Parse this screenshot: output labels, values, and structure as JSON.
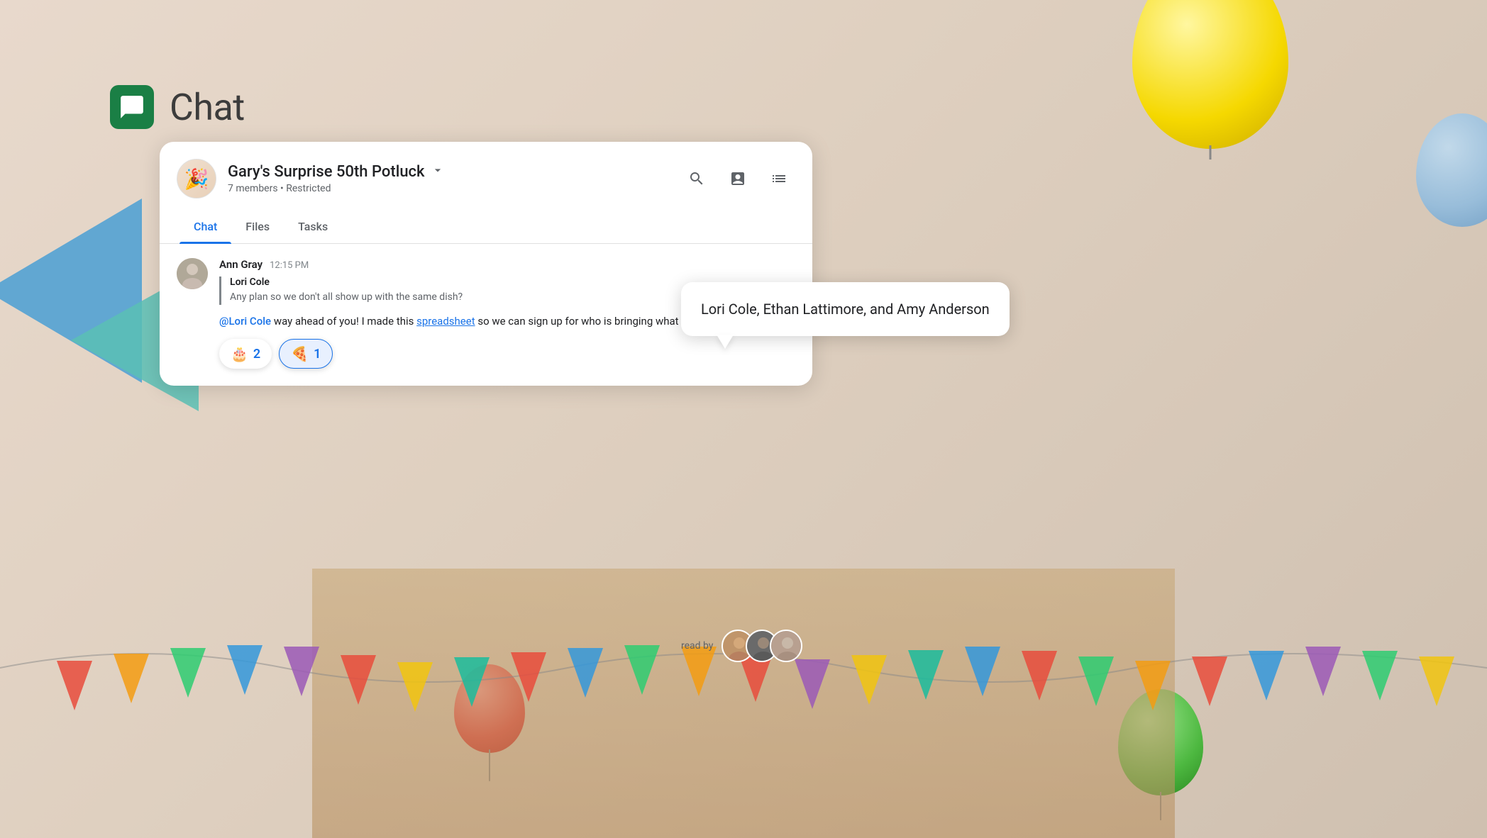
{
  "app": {
    "title": "Chat",
    "icon_emoji": "💬"
  },
  "group": {
    "name": "Gary's Surprise 50th Potluck",
    "members_count": "7 members",
    "restriction": "Restricted",
    "avatar_emoji": "🎉",
    "meta": "7 members • Restricted"
  },
  "tabs": [
    {
      "id": "chat",
      "label": "Chat",
      "active": true
    },
    {
      "id": "files",
      "label": "Files",
      "active": false
    },
    {
      "id": "tasks",
      "label": "Tasks",
      "active": false
    }
  ],
  "header_actions": [
    {
      "id": "search",
      "icon": "search"
    },
    {
      "id": "video",
      "icon": "video"
    },
    {
      "id": "list",
      "icon": "list"
    }
  ],
  "message": {
    "sender": "Ann Gray",
    "time": "12:15 PM",
    "quoted_sender": "Lori Cole",
    "quoted_text": "Any plan so we don't all show up with the same dish?",
    "text_before_mention": "",
    "mention": "@Lori Cole",
    "text_after_mention": " way ahead of you! I made this ",
    "link_text": "spreadsheet",
    "text_end": " so we can sign up for who is bringing what"
  },
  "reactions": [
    {
      "emoji": "🎂",
      "count": "2",
      "active": false
    },
    {
      "emoji": "🍕",
      "count": "1",
      "active": true
    }
  ],
  "tooltip": {
    "text": "Lori Cole, Ethan Lattimore, and Amy Anderson"
  },
  "read_by": {
    "label": "read by",
    "avatars": [
      {
        "id": "avatar1",
        "bg": "#8B6B55"
      },
      {
        "id": "avatar2",
        "bg": "#5C5C5C"
      },
      {
        "id": "avatar3",
        "bg": "#9B8B7A"
      }
    ]
  }
}
